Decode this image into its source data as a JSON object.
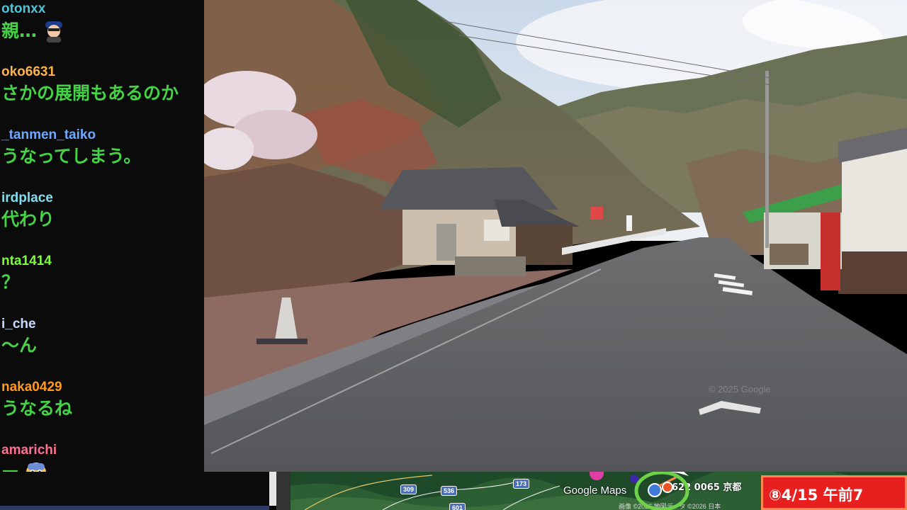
{
  "chat": {
    "messages": [
      {
        "user": "otonxx",
        "user_color": "#4fc3d9",
        "text": "親…",
        "emoji": "avatar-emote"
      },
      {
        "user": "oko6631",
        "user_color": "#ffb347",
        "text": "さかの展開もあるのか"
      },
      {
        "user": "_tanmen_taiko",
        "user_color": "#6fa8ff",
        "text": "うなってしまう。"
      },
      {
        "user": "irdplace",
        "user_color": "#7ee0f0",
        "text": "代わり"
      },
      {
        "user": "nta1414",
        "user_color": "#7cfc3c",
        "text": "？"
      },
      {
        "user": "i_che",
        "user_color": "#c8d8ff",
        "text": "〜ん"
      },
      {
        "user": "naka0429",
        "user_color": "#ff9a1f",
        "text": "うなるね"
      },
      {
        "user": "amarichi",
        "user_color": "#ff6f91",
        "text": "ー",
        "emoji": "fearful-face-emoji"
      }
    ]
  },
  "streetview": {
    "watermark": "© 2025 Google"
  },
  "map": {
    "brand": "Google Maps",
    "road_numbers": [
      "309",
      "536",
      "173",
      "601"
    ],
    "place_label": "622 0065 京都",
    "copyright": "画像 ©2026 地図データ ©2026 日本"
  },
  "banner": {
    "text": "⑧4/15 午前7"
  },
  "colors": {
    "chat_bg": "#0b0b0b",
    "chat_text": "#46d246",
    "banner_bg": "#e81f1f",
    "banner_border": "#ff8a50"
  }
}
